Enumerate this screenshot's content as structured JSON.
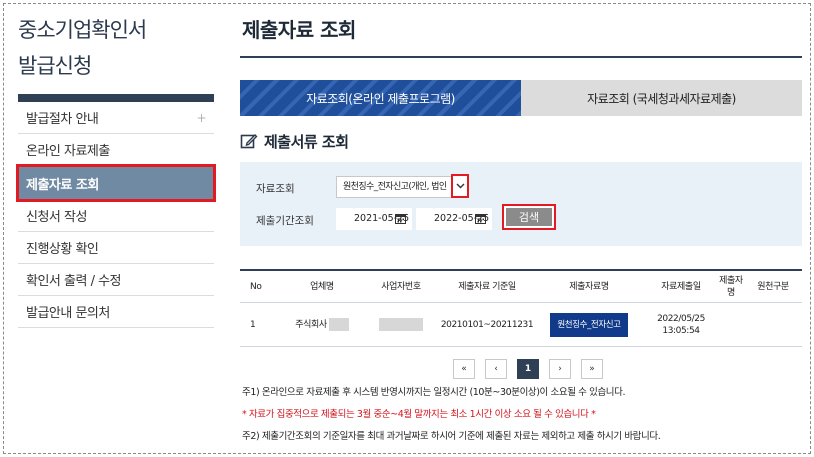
{
  "sidebar": {
    "title_line1": "중소기업확인서",
    "title_line2": "발급신청",
    "items": [
      {
        "label": "발급절차 안내",
        "plus": "+"
      },
      {
        "label": "온라인 자료제출"
      },
      {
        "label": "제출자료 조회"
      },
      {
        "label": "신청서 작성"
      },
      {
        "label": "진행상황 확인"
      },
      {
        "label": "확인서 출력 / 수정"
      },
      {
        "label": "발급안내 문의처"
      }
    ]
  },
  "main": {
    "title": "제출자료 조회",
    "tabs": [
      {
        "label": "자료조회(온라인 제출프로그램)"
      },
      {
        "label": "자료조회 (국세청과세자료제출)"
      }
    ],
    "section_title": "제출서류 조회",
    "search": {
      "type_label": "자료조회",
      "type_value": "원천징수_전자신고(개인, 법인",
      "period_label": "제출기간조회",
      "date_from": "2021-05-25",
      "date_to": "2022-05-25",
      "search_button": "검색"
    },
    "table": {
      "headers": [
        "No",
        "업체명",
        "사업자번호",
        "제출자료 기준일",
        "제출자료명",
        "자료제출일",
        "제출자명",
        "원천구분"
      ],
      "rows": [
        {
          "no": "1",
          "company": "주식회사",
          "date_range": "20210101~20211231",
          "doc": "원천징수_전자신고",
          "submit_date": "2022/05/25",
          "submit_time": "13:05:54"
        }
      ]
    },
    "pager": {
      "first": "«",
      "prev": "‹",
      "current": "1",
      "next": "›",
      "last": "»"
    },
    "notes": [
      "주1) 온라인으로 자료제출 후 시스템 반영시까지는 일정시간 (10분~30분이상)이 소요될 수 있습니다.",
      "* 자료가 집중적으로 제출되는 3월 중순~4월 말까지는 최소 1시간 이상 소요 될 수 있습니다 *",
      "주2) 제출기간조회의 기준일자를 최대 과거날짜로 하시어 기준에 제출된 자료는 제외하고 제출 하시기 바랍니다."
    ]
  }
}
